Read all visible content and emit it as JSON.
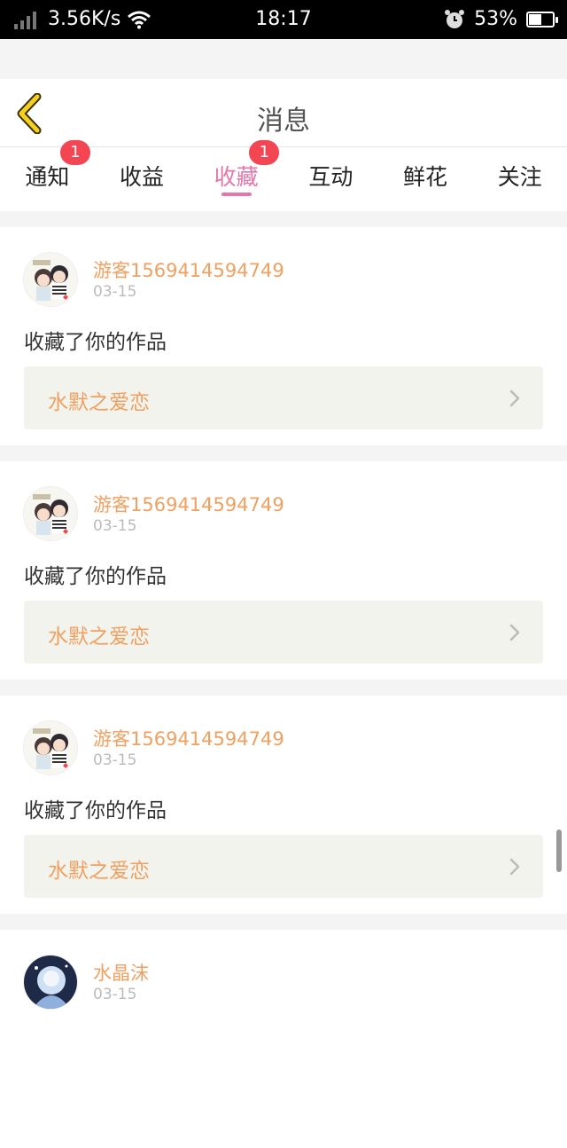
{
  "status_bar": {
    "speed": "3.56K/s",
    "time": "18:17",
    "battery": "53%",
    "battery_level": 0.53
  },
  "header": {
    "title": "消息"
  },
  "tabs": [
    {
      "label": "通知",
      "badge": "1",
      "active": false
    },
    {
      "label": "收益",
      "badge": "",
      "active": false
    },
    {
      "label": "收藏",
      "badge": "1",
      "active": true
    },
    {
      "label": "互动",
      "badge": "",
      "active": false
    },
    {
      "label": "鲜花",
      "badge": "",
      "active": false
    },
    {
      "label": "关注",
      "badge": "",
      "active": false
    }
  ],
  "items": [
    {
      "user": "游客1569414594749",
      "date": "03-15",
      "action": "收藏了你的作品",
      "work": "水默之爱恋"
    },
    {
      "user": "游客1569414594749",
      "date": "03-15",
      "action": "收藏了你的作品",
      "work": "水默之爱恋"
    },
    {
      "user": "游客1569414594749",
      "date": "03-15",
      "action": "收藏了你的作品",
      "work": "水默之爱恋"
    },
    {
      "user": "水晶沫",
      "date": "03-15",
      "action": "",
      "work": ""
    }
  ],
  "colors": {
    "accent": "#e477a8",
    "badge": "#f44552",
    "link_text": "#f0a060"
  }
}
